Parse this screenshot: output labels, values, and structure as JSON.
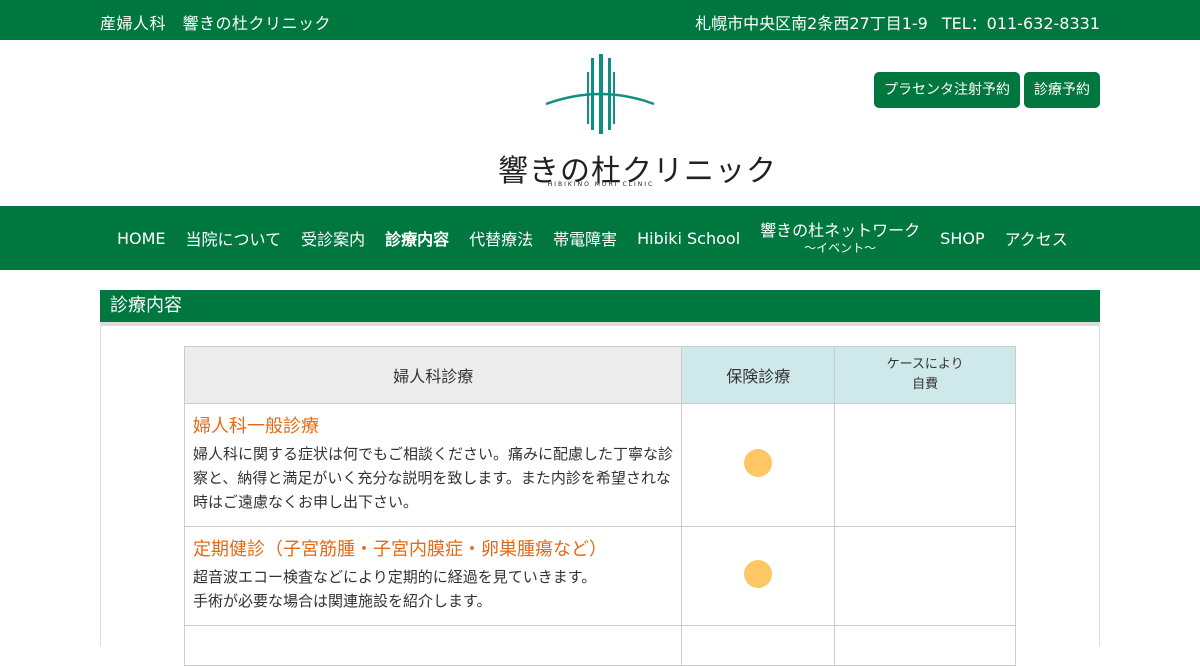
{
  "topbar": {
    "clinic_name": "産婦人科　響きの杜クリニック",
    "address": "札幌市中央区南2条西27丁目1-9",
    "tel": "TEL：011-632-8331"
  },
  "logo": {
    "text": "響きの杜クリニック",
    "subtext": "HIBIKINO MORI CLINIC"
  },
  "header_buttons": [
    {
      "label": "プラセンタ注射予約"
    },
    {
      "label": "診療予約"
    }
  ],
  "nav": {
    "items": [
      {
        "label": "HOME"
      },
      {
        "label": "当院について"
      },
      {
        "label": "受診案内"
      },
      {
        "label": "診療内容"
      },
      {
        "label": "代替療法"
      },
      {
        "label": "帯電障害"
      },
      {
        "label": "Hibiki School"
      },
      {
        "label": "響きの杜ネットワーク",
        "sub": "～イベント～"
      },
      {
        "label": "SHOP"
      },
      {
        "label": "アクセス"
      }
    ],
    "active": "診療内容"
  },
  "section": {
    "title": "診療内容"
  },
  "table": {
    "headers": {
      "main": "婦人科診療",
      "insurance": "保険診療",
      "self_line1": "ケースにより",
      "self_line2": "自費"
    },
    "rows": [
      {
        "title": "婦人科一般診療",
        "text": "婦人科に関する症状は何でもご相談ください。痛みに配慮した丁寧な診察と、納得と満足がいく充分な説明を致します。また内診を希望されな時はご遠慮なくお申し出下さい。",
        "insurance": true,
        "self_pay": false
      },
      {
        "title": "定期健診（子宮筋腫・子宮内膜症・卵巣腫瘍など）",
        "text_line1": "超音波エコー検査などにより定期的に経過を見ていきます。",
        "text_line2": "手術が必要な場合は関連施設を紹介します。",
        "insurance": true,
        "self_pay": false
      }
    ]
  },
  "colors": {
    "brand_green": "#00773f",
    "accent_orange": "#e46a16",
    "dot_yellow": "#fdc766",
    "header_teal": "#cfe9ea"
  }
}
